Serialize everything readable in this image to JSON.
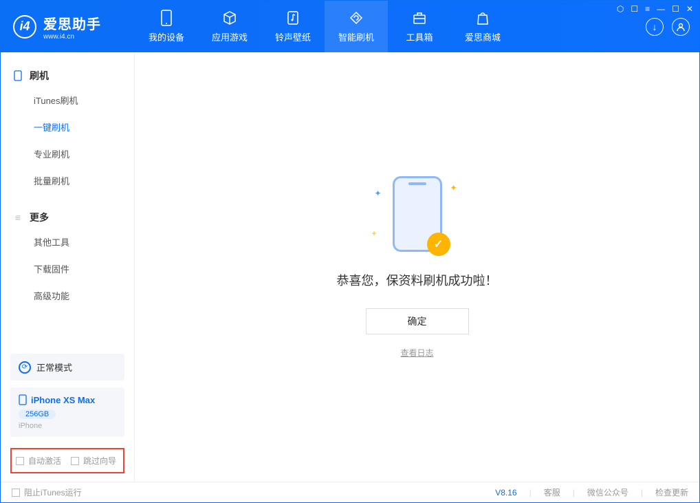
{
  "app": {
    "title": "爱思助手",
    "subtitle": "www.i4.cn"
  },
  "nav": [
    {
      "label": "我的设备"
    },
    {
      "label": "应用游戏"
    },
    {
      "label": "铃声壁纸"
    },
    {
      "label": "智能刷机"
    },
    {
      "label": "工具箱"
    },
    {
      "label": "爱思商城"
    }
  ],
  "sidebar": {
    "section1": {
      "title": "刷机",
      "items": [
        "iTunes刷机",
        "一键刷机",
        "专业刷机",
        "批量刷机"
      ]
    },
    "section2": {
      "title": "更多",
      "items": [
        "其他工具",
        "下载固件",
        "高级功能"
      ]
    }
  },
  "mode": {
    "label": "正常模式"
  },
  "device": {
    "name": "iPhone XS Max",
    "capacity": "256GB",
    "type": "iPhone"
  },
  "bottom_opts": {
    "auto_activate": "自动激活",
    "skip_guide": "跳过向导"
  },
  "main": {
    "message": "恭喜您，保资料刷机成功啦！",
    "ok": "确定",
    "log": "查看日志"
  },
  "statusbar": {
    "block_itunes": "阻止iTunes运行",
    "version": "V8.16",
    "links": [
      "客服",
      "微信公众号",
      "检查更新"
    ]
  }
}
